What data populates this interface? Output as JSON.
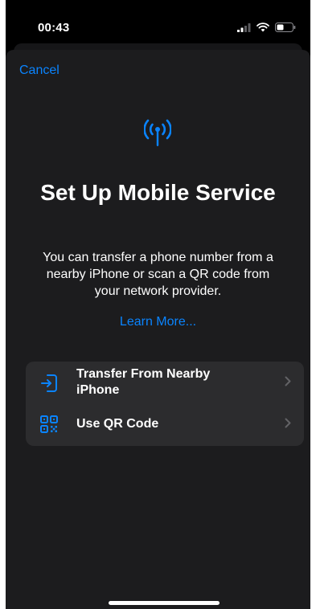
{
  "status_bar": {
    "time": "00:43"
  },
  "sheet": {
    "cancel_label": "Cancel",
    "icon": "antenna-signal-icon",
    "title": "Set Up Mobile Service",
    "description": "You can transfer a phone number from a nearby iPhone or scan a QR code from your network provider.",
    "learn_more_label": "Learn More..."
  },
  "options": [
    {
      "label": "Transfer From Nearby iPhone",
      "icon": "transfer-icon"
    },
    {
      "label": "Use QR Code",
      "icon": "qr-code-icon"
    }
  ],
  "colors": {
    "accent": "#0a84ff",
    "background": "#000000",
    "sheet": "#1c1c1e",
    "card": "#2c2c2e"
  }
}
